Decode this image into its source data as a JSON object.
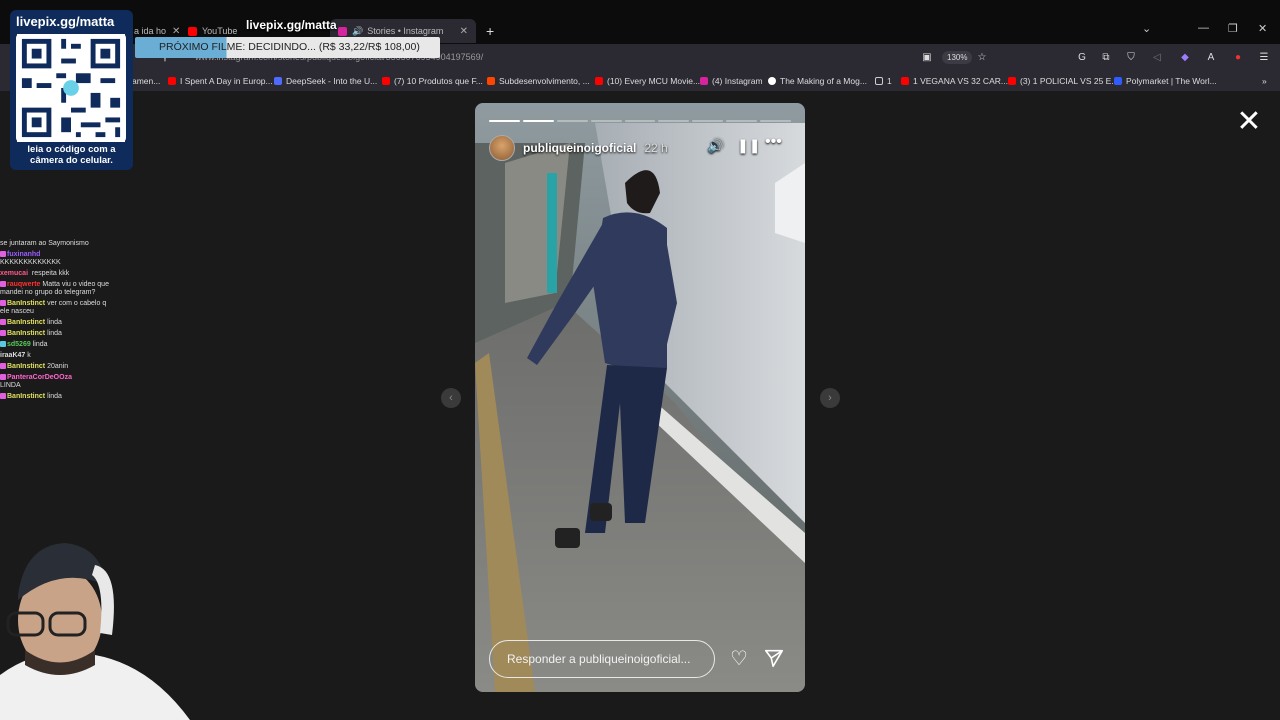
{
  "tabs": [
    {
      "label": "a ida ho",
      "color": "#cc2a2a"
    },
    {
      "label": "YouTube",
      "color": "#ff0000"
    },
    {
      "label": "Stories • Instagram",
      "color": "#d6249f",
      "active": true
    }
  ],
  "address_bar": {
    "url": "www.instagram.com/stories/publiqueinoigoficial/3565076954904197569/",
    "zoom": "130%"
  },
  "bookmarks": [
    {
      "label": "amen...",
      "color": "#4a7bd0"
    },
    {
      "label": "I Spent A Day in Europ...",
      "color": "#ff0000"
    },
    {
      "label": "DeepSeek - Into the U...",
      "color": "#4d6bfe"
    },
    {
      "label": "(7) 10 Produtos que F...",
      "color": "#ff0000"
    },
    {
      "label": "Subdesenvolvimento, ...",
      "color": "#ff4500"
    },
    {
      "label": "(10) Every MCU Movie...",
      "color": "#ff0000"
    },
    {
      "label": "(4) Instagram",
      "color": "#d6249f"
    },
    {
      "label": "The Making of a Mog...",
      "color": "#ffffff"
    },
    {
      "label": "1",
      "color": "#cccccc"
    },
    {
      "label": "1 VEGANA VS 32 CAR...",
      "color": "#ff0000"
    },
    {
      "label": "(3) 1 POLICIAL VS 25 E...",
      "color": "#ff0000"
    },
    {
      "label": "Polymarket | The Worl...",
      "color": "#2e5cff"
    }
  ],
  "overlay": {
    "site": "livepix.gg/matta",
    "qr_title": "livepix.gg/matta",
    "qr_caption": "leia o código com a câmera do celular.",
    "next_film": "PRÓXIMO FILME: DECIDINDO... (R$ 33,22/R$ 108,00)"
  },
  "chat": [
    {
      "user": "",
      "text": "se juntaram ao Saymonismo",
      "color": "#dddddd"
    },
    {
      "user": "fuxinanhd",
      "text": "KKKKKKKKKKKKK",
      "color": "#9b5cff"
    },
    {
      "user": "xemucai",
      "text": "respeita kkk",
      "color": "#ff5a8a"
    },
    {
      "user": "rauqwerte",
      "text": "Matta viu o video que mandei no grupo do telegram?",
      "color": "#ff3030"
    },
    {
      "user": "BanInstinct",
      "text": "ver com o cabelo q ele nasceu",
      "color": "#e0e060"
    },
    {
      "user": "BanInstinct",
      "text": "linda",
      "color": "#e0e060"
    },
    {
      "user": "BanInstinct",
      "text": "linda",
      "color": "#e0e060"
    },
    {
      "user": "sd5269",
      "text": "linda",
      "color": "#5ac85a"
    },
    {
      "user": "iraaK47",
      "text": "k",
      "color": "#dddddd"
    },
    {
      "user": "BanInstinct",
      "text": "20anin",
      "color": "#e0e060"
    },
    {
      "user": "PanteraCorDeOOza",
      "text": "LINDA",
      "color": "#ff66cc"
    },
    {
      "user": "BanInstinct",
      "text": "linda",
      "color": "#e0e060"
    }
  ],
  "story": {
    "username": "publiqueinoigoficial",
    "time": "22 h",
    "segments_total": 9,
    "segments_done": 2,
    "reply_placeholder": "Responder a publiqueinoigoficial..."
  },
  "icons": {
    "close": "close-icon",
    "mute": "volume-icon",
    "pause": "pause-icon",
    "more": "more-icon",
    "like": "heart-icon",
    "send": "send-icon",
    "prev": "chevron-left-icon",
    "next": "chevron-right-icon"
  }
}
